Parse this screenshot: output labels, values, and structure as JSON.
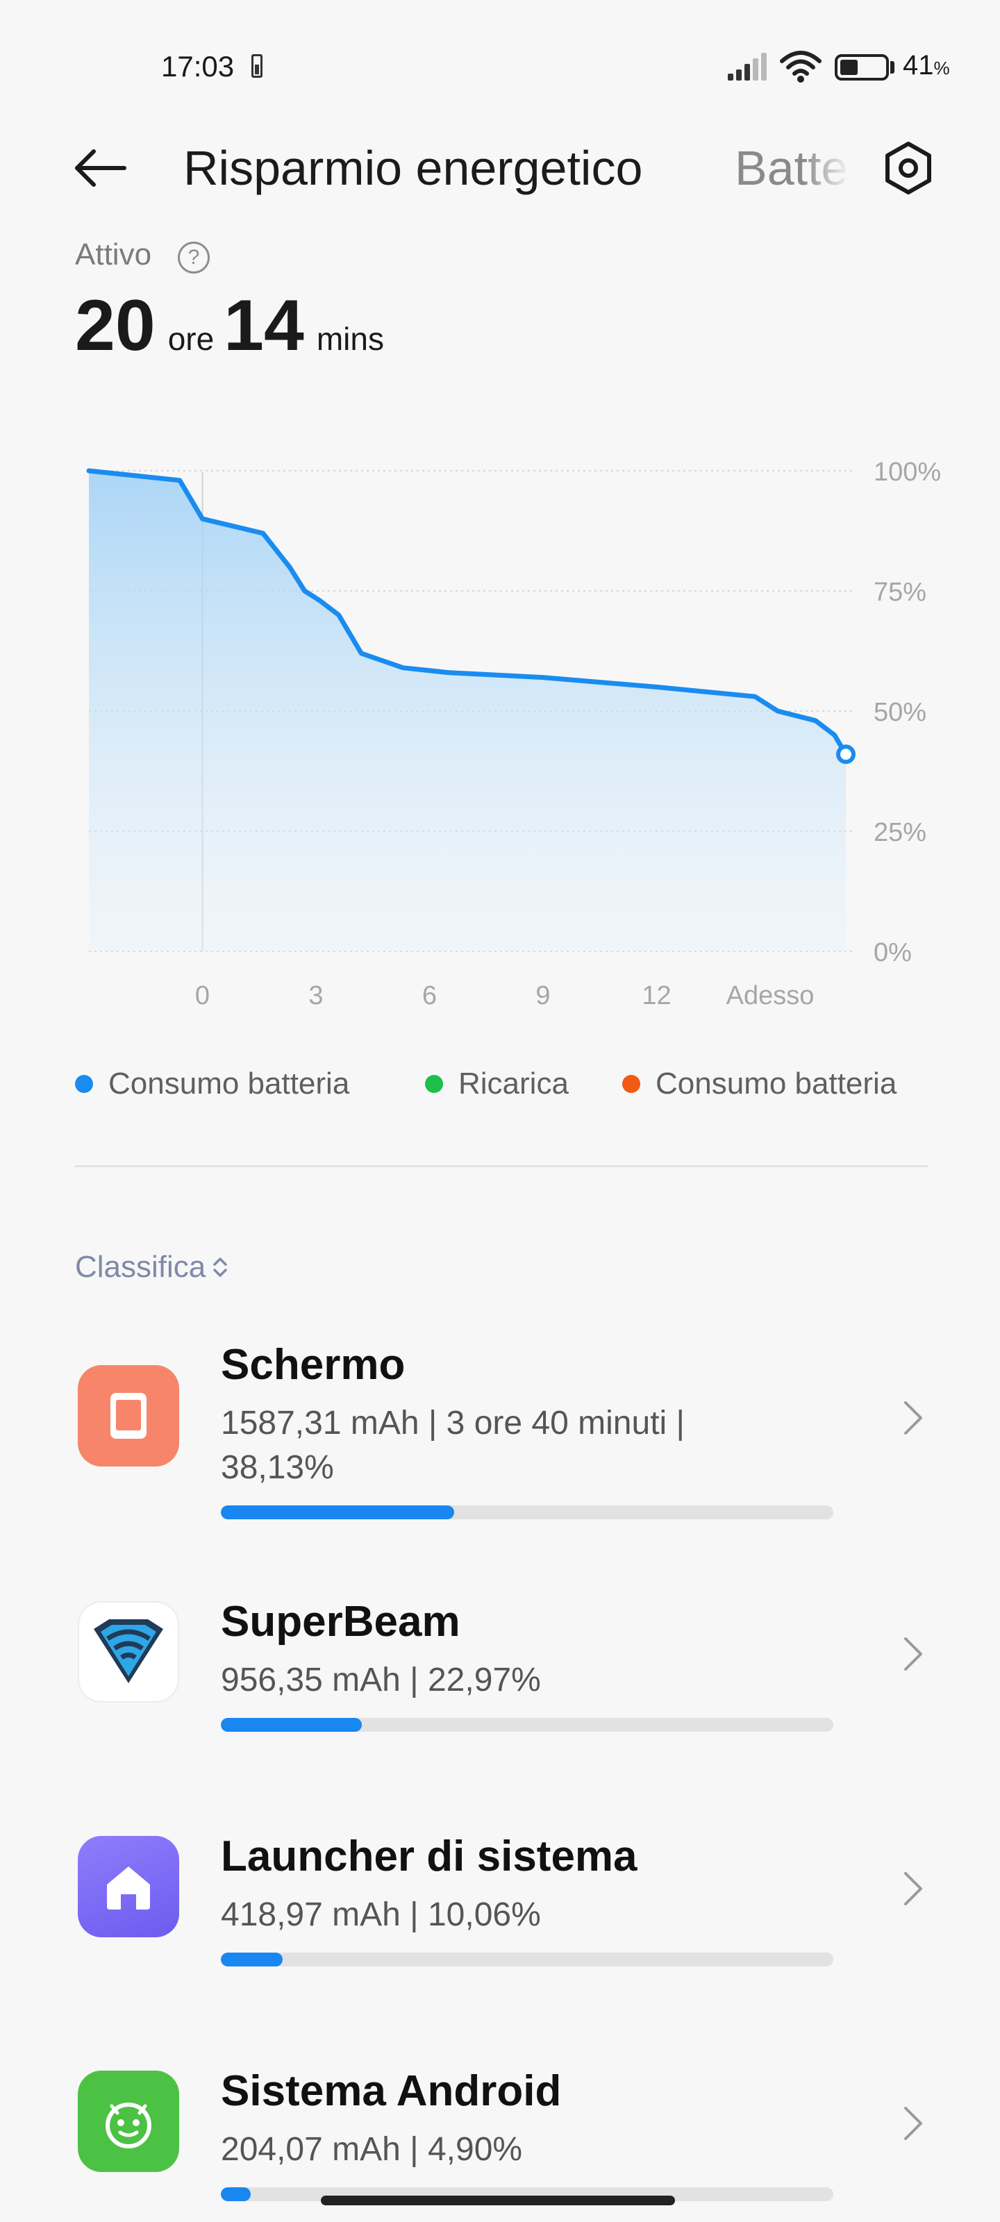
{
  "status_bar": {
    "time": "17:03",
    "battery_percent": "41",
    "battery_unit": "%",
    "battery_level": 0.41
  },
  "header": {
    "back_icon": "arrow-left-icon",
    "title": "Risparmio energetico",
    "tab2": "Batteria",
    "settings_icon": "gear-hexagon-icon"
  },
  "summary": {
    "label": "Attivo",
    "help_icon": "question-circle-icon",
    "hours": "20",
    "hours_unit": "ore",
    "minutes": "14",
    "minutes_unit": "mins"
  },
  "chart_data": {
    "type": "area",
    "x_tick_labels": [
      "0",
      "3",
      "6",
      "9",
      "12",
      "Adesso"
    ],
    "y_tick_labels": [
      "100%",
      "75%",
      "50%",
      "25%",
      "0%"
    ],
    "ylim": [
      0,
      100
    ],
    "xlim": [
      -3,
      17
    ],
    "series": [
      {
        "name": "Consumo batteria",
        "color": "#1a8cf0",
        "x": [
          -3,
          -0.6,
          0,
          1.6,
          2.3,
          2.7,
          3.1,
          3.6,
          4.2,
          5.3,
          6.5,
          9,
          12,
          14.6,
          15.2,
          16.2,
          16.7,
          17
        ],
        "y": [
          100,
          98,
          90,
          87,
          80,
          75,
          73,
          70,
          62,
          59,
          58,
          57,
          55,
          53,
          50,
          48,
          45,
          41
        ]
      }
    ],
    "grid": true
  },
  "legend": [
    {
      "label": "Consumo batteria",
      "color": "#1a8cf0"
    },
    {
      "label": "Ricarica",
      "color": "#1dbf4a"
    },
    {
      "label": "Consumo batteria",
      "color": "#f05a14"
    }
  ],
  "ranking": {
    "label": "Classifica",
    "sort_icon": "sort-updown-icon"
  },
  "apps": [
    {
      "name": "Schermo",
      "detail": "1587,31 mAh | 3 ore 40 minuti  | 38,13%",
      "share": 0.3813,
      "icon": "screen-icon",
      "icon_color": "#f7856a"
    },
    {
      "name": "SuperBeam",
      "detail": "956,35 mAh | 22,97%",
      "share": 0.2297,
      "icon": "superbeam-icon",
      "icon_color": "#ffffff"
    },
    {
      "name": "Launcher di sistema",
      "detail": "418,97 mAh | 10,06%",
      "share": 0.1006,
      "icon": "home-icon",
      "icon_color": "#7b6cf6"
    },
    {
      "name": "Sistema Android",
      "detail": "204,07 mAh | 4,90%",
      "share": 0.049,
      "icon": "android-icon",
      "icon_color": "#4cc244"
    }
  ]
}
